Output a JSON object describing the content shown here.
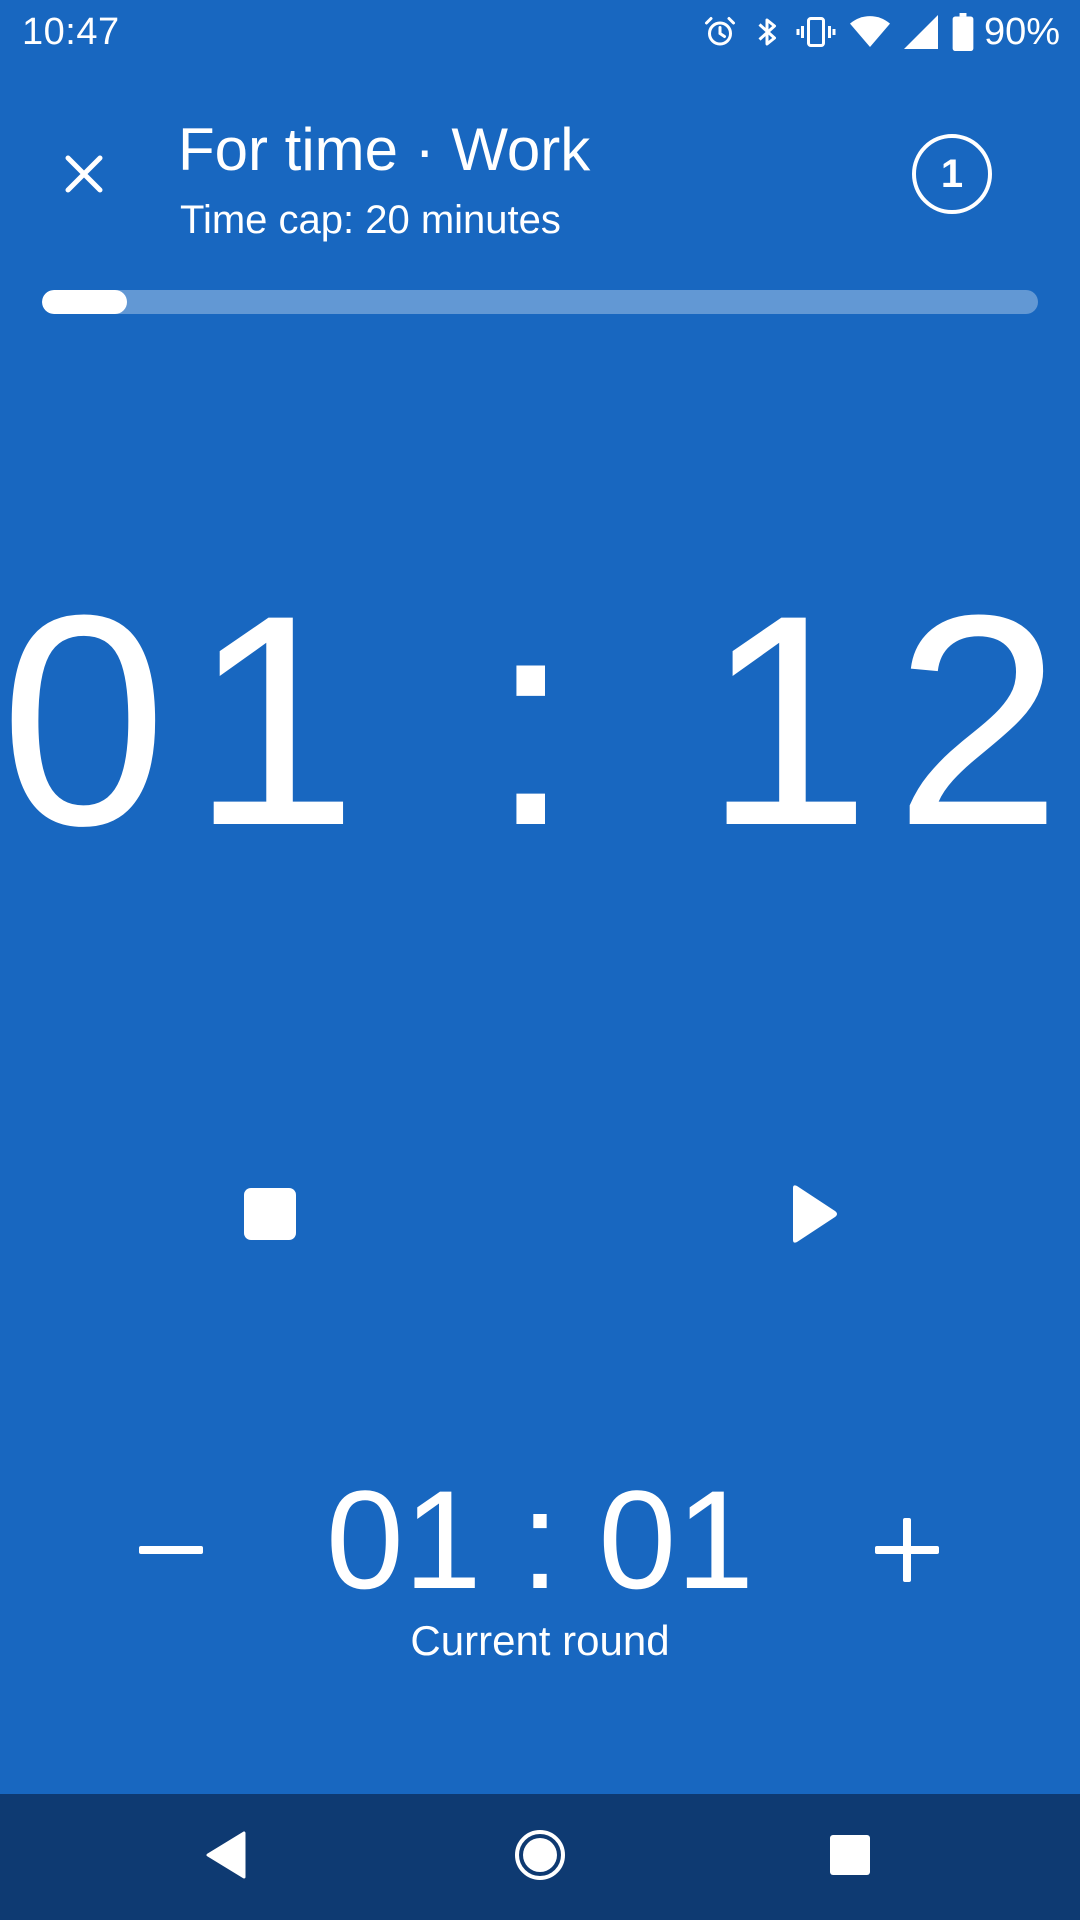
{
  "status_bar": {
    "time": "10:47",
    "battery_percent": "90%",
    "icons": [
      "alarm-icon",
      "bluetooth-icon",
      "vibrate-icon",
      "wifi-icon",
      "cell-signal-icon",
      "battery-icon"
    ]
  },
  "header": {
    "title": "For time · Work",
    "subtitle": "Time cap: 20 minutes",
    "round_badge": "1",
    "close_icon": "close-icon"
  },
  "progress": {
    "fraction": 0.085
  },
  "timer": {
    "main": "01 : 12"
  },
  "controls": {
    "stop_icon": "stop-icon",
    "play_icon": "play-icon"
  },
  "round": {
    "time": "01 : 01",
    "label": "Current round",
    "minus_icon": "minus-icon",
    "plus_icon": "plus-icon"
  },
  "nav": {
    "icons": [
      "back-icon",
      "home-icon",
      "recents-icon"
    ]
  },
  "colors": {
    "background": "#1867C0",
    "nav_background": "#0E3A72",
    "foreground": "#FFFFFF"
  }
}
